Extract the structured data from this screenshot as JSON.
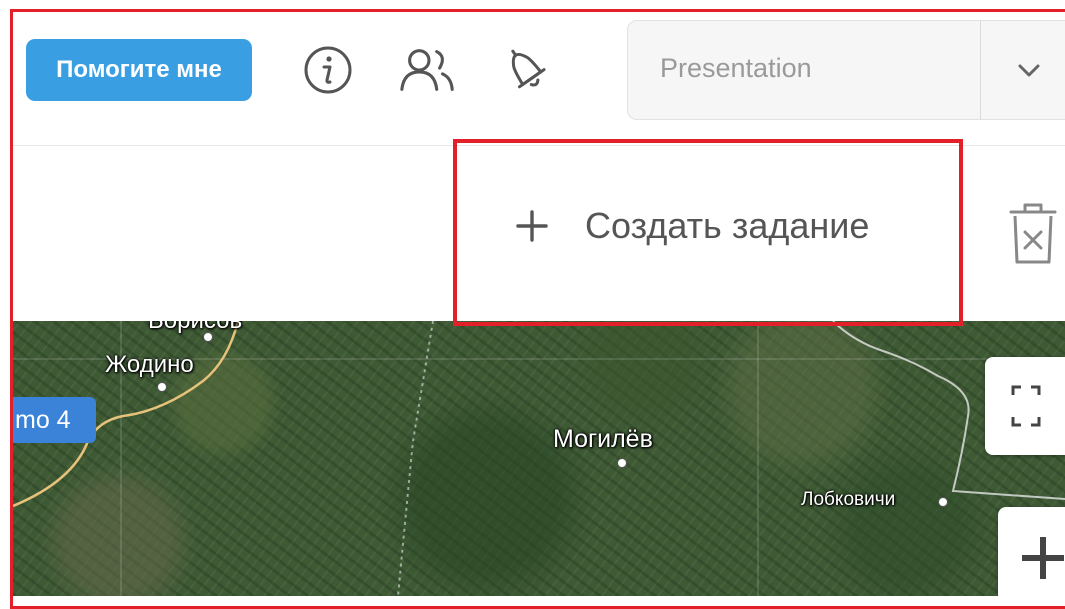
{
  "header": {
    "help_button_label": "Помогите мне",
    "icons": [
      "info-icon",
      "users-icon",
      "bell-icon"
    ],
    "preset_select_value": "Presentation"
  },
  "toolbar": {
    "create_task_label": "Создать задание"
  },
  "map": {
    "labels": {
      "borisov": "Борисов",
      "zhodino": "Жодино",
      "mogilev": "Могилёв",
      "lobkovichi": "Лобковичи"
    },
    "layer_badge": "mo 4"
  },
  "colors": {
    "accent": "#3a9ee2",
    "highlight": "#e3202a",
    "layer_badge": "#3a83d8"
  }
}
